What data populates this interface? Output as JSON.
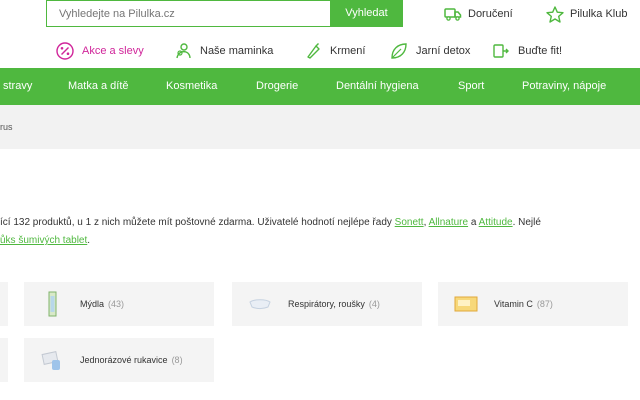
{
  "search": {
    "placeholder": "Vyhledejte na Pilulka.cz",
    "button_label": "Vyhledat"
  },
  "header_links": [
    {
      "label": "Doručení",
      "icon": "truck-icon"
    },
    {
      "label": "Pilulka Klub",
      "icon": "star-icon"
    }
  ],
  "promo": [
    {
      "label": "Akce a slevy",
      "icon": "percent-icon",
      "color": "#d0259a"
    },
    {
      "label": "Naše maminka",
      "icon": "mother-icon"
    },
    {
      "label": "Krmení",
      "icon": "bottle-icon"
    },
    {
      "label": "Jarní detox",
      "icon": "leaf-icon"
    },
    {
      "label": "Buďte fit!",
      "icon": "fitness-icon"
    }
  ],
  "nav": [
    {
      "label": "stravy"
    },
    {
      "label": "Matka a dítě"
    },
    {
      "label": "Kosmetika"
    },
    {
      "label": "Drogerie"
    },
    {
      "label": "Dentální hygiena"
    },
    {
      "label": "Sport"
    },
    {
      "label": "Potraviny, nápoje"
    }
  ],
  "breadcrumb": "rus",
  "description": {
    "part1": "ící 132 produktů, u 1 z nich můžete mít poštovné zdarma. Uživatelé hodnotí nejlépe řady ",
    "link1": "Sonett",
    "sep1": ", ",
    "link2": "Allnature",
    "sep2": " a ",
    "link3": "Attitude",
    "part2": ". Nejlé",
    "line2_link": "ůks šumivých tablet",
    "line2_end": "."
  },
  "tiles": [
    {
      "label": "Mýdla",
      "count": "(43)"
    },
    {
      "label": "Respirátory, roušky",
      "count": "(4)"
    },
    {
      "label": "Vitamin C",
      "count": "(87)"
    },
    {
      "label": "Jednorázové rukavice",
      "count": "(8)"
    }
  ],
  "colors": {
    "brand_green": "#4fb83f",
    "sale_pink": "#d0259a"
  }
}
